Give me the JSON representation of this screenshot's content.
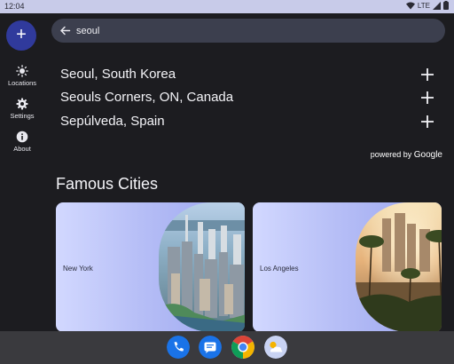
{
  "status_bar": {
    "time": "12:04",
    "network": "LTE"
  },
  "rail": {
    "fab_label": "+",
    "items": [
      {
        "label": "Locations",
        "icon": "sun-icon"
      },
      {
        "label": "Settings",
        "icon": "gear-icon"
      },
      {
        "label": "About",
        "icon": "info-icon"
      }
    ]
  },
  "search": {
    "value": "seoul",
    "back_icon": "arrow-left-icon"
  },
  "results": [
    {
      "label": "Seoul, South Korea",
      "action_icon": "plus-icon"
    },
    {
      "label": "Seouls Corners, ON, Canada",
      "action_icon": "plus-icon"
    },
    {
      "label": "Sepúlveda, Spain",
      "action_icon": "plus-icon"
    }
  ],
  "attribution": {
    "prefix": "powered by",
    "brand": "Google"
  },
  "famous": {
    "title": "Famous Cities",
    "cities": [
      {
        "name": "New York"
      },
      {
        "name": "Los Angeles"
      }
    ]
  },
  "taskbar": {
    "apps": [
      "phone-icon",
      "messages-icon",
      "chrome-icon",
      "weather-icon"
    ]
  },
  "colors": {
    "status_bar": "#c8cbe9",
    "background": "#1c1c20",
    "fab": "#303a9c",
    "search_bar": "#3c3f4e",
    "card_gradient_start": "#d2d8ff",
    "card_gradient_end": "#99a4ef",
    "taskbar": "#3a3a3e"
  }
}
